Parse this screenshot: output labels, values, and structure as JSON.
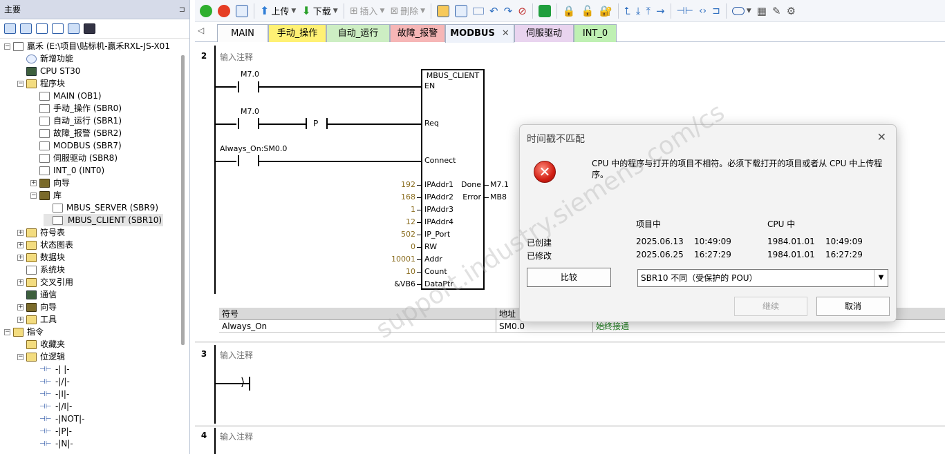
{
  "left_panel": {
    "title": "主要",
    "pin": "⊐",
    "tree": [
      {
        "label": "贏禾 (E:\\项目\\贴标机-贏禾RXL-JS-X01",
        "indent": 0,
        "icon": "project",
        "exp": "−"
      },
      {
        "label": "新增功能",
        "indent": 1,
        "icon": "help"
      },
      {
        "label": "CPU ST30",
        "indent": 1,
        "icon": "cpu"
      },
      {
        "label": "程序块",
        "indent": 1,
        "icon": "folder",
        "exp": "−"
      },
      {
        "label": "MAIN (OB1)",
        "indent": 2,
        "icon": "pou"
      },
      {
        "label": "手动_操作 (SBR0)",
        "indent": 2,
        "icon": "pou"
      },
      {
        "label": "自动_运行 (SBR1)",
        "indent": 2,
        "icon": "pou"
      },
      {
        "label": "故障_报警 (SBR2)",
        "indent": 2,
        "icon": "pou"
      },
      {
        "label": "MODBUS (SBR7)",
        "indent": 2,
        "icon": "pou"
      },
      {
        "label": "伺服驱动 (SBR8)",
        "indent": 2,
        "icon": "pou"
      },
      {
        "label": "INT_0 (INT0)",
        "indent": 2,
        "icon": "pou"
      },
      {
        "label": "向导",
        "indent": 2,
        "icon": "wizard",
        "exp": "+"
      },
      {
        "label": "库",
        "indent": 2,
        "icon": "wizard",
        "exp": "−"
      },
      {
        "label": "MBUS_SERVER (SBR9)",
        "indent": 3,
        "icon": "pou"
      },
      {
        "label": "MBUS_CLIENT (SBR10)",
        "indent": 3,
        "icon": "pou",
        "selected": true
      },
      {
        "label": "符号表",
        "indent": 1,
        "icon": "folder",
        "exp": "+"
      },
      {
        "label": "状态图表",
        "indent": 1,
        "icon": "folder",
        "exp": "+"
      },
      {
        "label": "数据块",
        "indent": 1,
        "icon": "folder",
        "exp": "+"
      },
      {
        "label": "系统块",
        "indent": 1,
        "icon": "block"
      },
      {
        "label": "交叉引用",
        "indent": 1,
        "icon": "folder",
        "exp": "+"
      },
      {
        "label": "通信",
        "indent": 1,
        "icon": "comm"
      },
      {
        "label": "向导",
        "indent": 1,
        "icon": "wizard",
        "exp": "+"
      },
      {
        "label": "工具",
        "indent": 1,
        "icon": "folder",
        "exp": "+"
      },
      {
        "label": "指令",
        "indent": 0,
        "icon": "folder",
        "exp": "−"
      },
      {
        "label": "收藏夹",
        "indent": 1,
        "icon": "folder"
      },
      {
        "label": "位逻辑",
        "indent": 1,
        "icon": "folder",
        "exp": "−"
      },
      {
        "label": "-| |-",
        "indent": 2,
        "icon": "ladder"
      },
      {
        "label": "-|/|-",
        "indent": 2,
        "icon": "ladder"
      },
      {
        "label": "-|I|-",
        "indent": 2,
        "icon": "ladder"
      },
      {
        "label": "-|/I|-",
        "indent": 2,
        "icon": "ladder"
      },
      {
        "label": "-|NOT|-",
        "indent": 2,
        "icon": "ladder"
      },
      {
        "label": "-|P|-",
        "indent": 2,
        "icon": "ladder"
      },
      {
        "label": "-|N|-",
        "indent": 2,
        "icon": "ladder"
      }
    ]
  },
  "toolbar": {
    "upload": "上传",
    "download": "下载",
    "insert": "插入",
    "delete": "删除"
  },
  "tabs": [
    {
      "label": "MAIN",
      "color": "#fcfcfc",
      "active": false
    },
    {
      "label": "手动_操作",
      "color": "#fff174",
      "active": false
    },
    {
      "label": "自动_运行",
      "color": "#cdeec3",
      "active": false
    },
    {
      "label": "故障_报警",
      "color": "#f6b6b6",
      "active": false
    },
    {
      "label": "MODBUS",
      "color": "#eef2fa",
      "active": true,
      "close": "✕"
    },
    {
      "label": "伺服驱动",
      "color": "#e9d4ef",
      "active": false
    },
    {
      "label": "INT_0",
      "color": "#bff0b3",
      "active": false
    }
  ],
  "editor": {
    "net2": "2",
    "net3": "3",
    "net4": "4",
    "comment": "输入注释",
    "contact1": "M7.0",
    "contact2": "M7.0",
    "contact3": "Always_On:SM0.0",
    "p_coil": "P",
    "fb_name": "MBUS_CLIENT",
    "pins_left": [
      {
        "pin": "EN",
        "value": ""
      },
      {
        "pin": "Req",
        "value": ""
      },
      {
        "pin": "Connect",
        "value": ""
      },
      {
        "pin": "IPAddr1",
        "value": "192"
      },
      {
        "pin": "IPAddr2",
        "value": "168"
      },
      {
        "pin": "IPAddr3",
        "value": "1"
      },
      {
        "pin": "IPAddr4",
        "value": "12"
      },
      {
        "pin": "IP_Port",
        "value": "502"
      },
      {
        "pin": "RW",
        "value": "0"
      },
      {
        "pin": "Addr",
        "value": "10001"
      },
      {
        "pin": "Count",
        "value": "10"
      },
      {
        "pin": "DataPtr",
        "value": "&VB6"
      }
    ],
    "pins_right": [
      {
        "pin": "Done",
        "value": "M7.1"
      },
      {
        "pin": "Error",
        "value": "MB8"
      }
    ],
    "symtable": {
      "headers": [
        "符号",
        "地址",
        ""
      ],
      "row": [
        "Always_On",
        "SM0.0",
        "始终接通"
      ]
    }
  },
  "dialog": {
    "title": "时间戳不匹配",
    "close": "✕",
    "message": "CPU 中的程序与打开的项目不相符。必须下载打开的项目或者从 CPU 中上传程序。",
    "col_project": "项目中",
    "col_cpu": "CPU 中",
    "row_created": "已创建",
    "row_modified": "已修改",
    "created_project": "2025.06.13    10:49:09",
    "created_cpu": "1984.01.01    10:49:09",
    "modified_project": "2025.06.25    16:27:29",
    "modified_cpu": "1984.01.01    16:27:29",
    "compare_button": "比较",
    "pou_select": "SBR10 不同（受保护的 POU）",
    "continue_button": "继续",
    "cancel_button": "取消",
    "error_glyph": "✕"
  },
  "watermark": "support.industry.siemens.com/cs"
}
